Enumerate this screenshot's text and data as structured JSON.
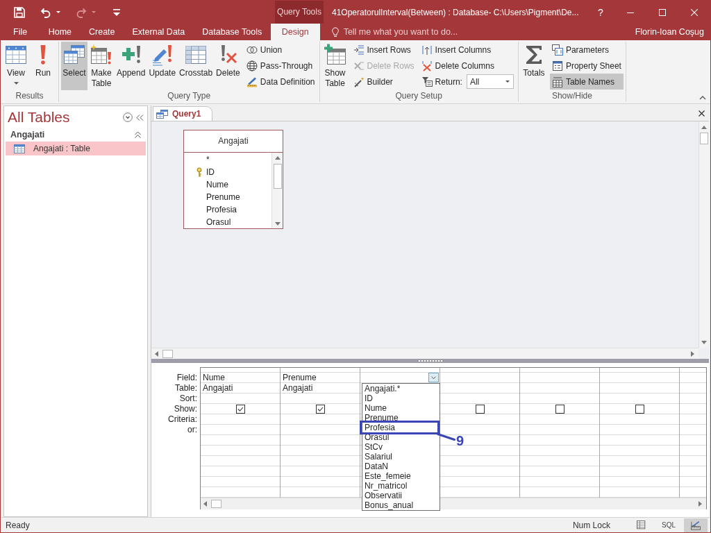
{
  "window": {
    "title": "41OperatorulInterval(Between) : Database- C:\\Users\\Pigment\\De...",
    "context_group": "Query Tools",
    "help": "?"
  },
  "quick_access": [
    {
      "kind": "save",
      "disabled": false
    },
    {
      "kind": "undo",
      "disabled": false
    },
    {
      "kind": "redo",
      "disabled": true
    },
    {
      "kind": "customize",
      "disabled": false
    }
  ],
  "tabs": [
    {
      "label": "File",
      "selected": false
    },
    {
      "label": "Home",
      "selected": false
    },
    {
      "label": "Create",
      "selected": false
    },
    {
      "label": "External Data",
      "selected": false
    },
    {
      "label": "Database Tools",
      "selected": false
    },
    {
      "label": "Design",
      "selected": true
    }
  ],
  "tell_me": {
    "placeholder": "Tell me what you want to do..."
  },
  "user": "Florin-Ioan Coşug",
  "ribbon": {
    "groups": [
      {
        "label": "Results",
        "large": [
          {
            "kind": "view",
            "label": "View",
            "dropdown": true,
            "selected": false
          },
          {
            "kind": "run",
            "label": "Run",
            "dropdown": false,
            "selected": false
          }
        ]
      },
      {
        "label": "Query Type",
        "large": [
          {
            "kind": "select",
            "label": "Select",
            "dropdown": false,
            "selected": true
          },
          {
            "kind": "make_table",
            "label": "Make Table",
            "dropdown": false,
            "selected": false
          },
          {
            "kind": "append",
            "label": "Append",
            "dropdown": false,
            "selected": false
          },
          {
            "kind": "update",
            "label": "Update",
            "dropdown": false,
            "selected": false
          },
          {
            "kind": "crosstab",
            "label": "Crosstab",
            "dropdown": false,
            "selected": false
          },
          {
            "kind": "delete",
            "label": "Delete",
            "dropdown": false,
            "selected": false
          }
        ],
        "columns": [
          [
            {
              "kind": "union",
              "label": "Union",
              "selected": false,
              "disabled": false
            },
            {
              "kind": "pass_through",
              "label": "Pass-Through",
              "selected": false,
              "disabled": false
            },
            {
              "kind": "data_definition",
              "label": "Data Definition",
              "selected": false,
              "disabled": false
            }
          ]
        ]
      },
      {
        "label": "Query Setup",
        "large": [
          {
            "kind": "show_table",
            "label": "Show Table",
            "dropdown": false,
            "selected": false
          }
        ],
        "columns": [
          [
            {
              "kind": "insert_rows",
              "label": "Insert Rows",
              "selected": false,
              "disabled": false
            },
            {
              "kind": "delete_rows",
              "label": "Delete Rows",
              "selected": false,
              "disabled": true
            },
            {
              "kind": "builder",
              "label": "Builder",
              "selected": false,
              "disabled": false
            }
          ],
          [
            {
              "kind": "insert_columns",
              "label": "Insert Columns",
              "selected": false,
              "disabled": false
            },
            {
              "kind": "delete_columns",
              "label": "Delete Columns",
              "selected": false,
              "disabled": false
            },
            {
              "kind": "return",
              "label": "Return:",
              "value": "All",
              "selected": false,
              "disabled": false
            }
          ]
        ]
      },
      {
        "label": "Show/Hide",
        "large": [
          {
            "kind": "totals",
            "label": "Totals",
            "dropdown": false,
            "selected": false
          }
        ],
        "columns": [
          [
            {
              "kind": "parameters",
              "label": "Parameters",
              "selected": false,
              "disabled": false
            },
            {
              "kind": "property_sheet",
              "label": "Property Sheet",
              "selected": false,
              "disabled": false
            },
            {
              "kind": "table_names",
              "label": "Table Names",
              "selected": true,
              "disabled": false
            }
          ]
        ]
      }
    ]
  },
  "nav_pane": {
    "title": "All Tables",
    "groups": [
      {
        "label": "Angajati",
        "expanded": true,
        "items": [
          {
            "label": "Angajati : Table",
            "selected": true
          }
        ]
      }
    ]
  },
  "document": {
    "tabs": [
      {
        "label": "Query1",
        "selected": true
      }
    ],
    "tables": [
      {
        "title": "Angajati",
        "fields": [
          {
            "label": "*",
            "primary_key": false
          },
          {
            "label": "ID",
            "primary_key": true
          },
          {
            "label": "Nume",
            "primary_key": false
          },
          {
            "label": "Prenume",
            "primary_key": false
          },
          {
            "label": "Profesia",
            "primary_key": false
          },
          {
            "label": "Orasul",
            "primary_key": false
          }
        ]
      }
    ]
  },
  "design_grid": {
    "row_labels": [
      "Field:",
      "Table:",
      "Sort:",
      "Show:",
      "Criteria:",
      "or:"
    ],
    "columns": [
      {
        "field": "Nume",
        "table": "Angajati",
        "show": true
      },
      {
        "field": "Prenume",
        "table": "Angajati",
        "show": true
      },
      {
        "dropdown": {
          "open": true,
          "callout_label": "9",
          "options": [
            {
              "label": "Angajati.*",
              "callout": false
            },
            {
              "label": "ID",
              "callout": false
            },
            {
              "label": "Nume",
              "callout": false
            },
            {
              "label": "Prenume",
              "callout": false
            },
            {
              "label": "Profesia",
              "callout": true
            },
            {
              "label": "Orasul",
              "callout": false
            },
            {
              "label": "StCv",
              "callout": false
            },
            {
              "label": "Salariul",
              "callout": false
            },
            {
              "label": "DataN",
              "callout": false
            },
            {
              "label": "Este_femeie",
              "callout": false
            },
            {
              "label": "Nr_matricol",
              "callout": false
            },
            {
              "label": "Observatii",
              "callout": false
            },
            {
              "label": "Bonus_anual",
              "callout": false
            }
          ]
        }
      },
      {
        "show": false
      },
      {
        "show": false
      },
      {
        "show": false
      }
    ]
  },
  "status_bar": {
    "text": "Ready",
    "indicators": [
      "Num Lock"
    ],
    "views": [
      {
        "kind": "datasheet",
        "selected": false
      },
      {
        "kind": "sql",
        "label": "SQL",
        "selected": false
      },
      {
        "kind": "design",
        "selected": true
      }
    ]
  }
}
